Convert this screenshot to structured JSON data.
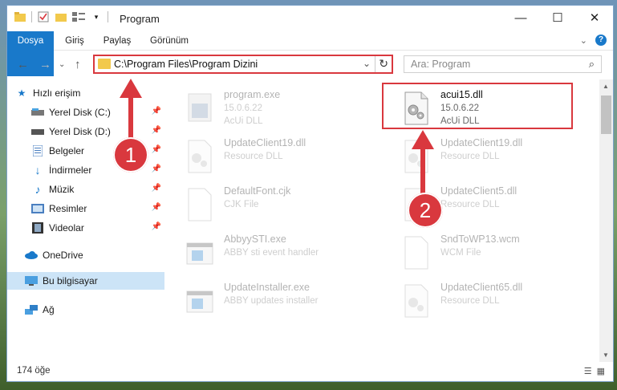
{
  "window": {
    "title": "Program",
    "controls": {
      "minimize": "—",
      "maximize": "☐",
      "close": "✕"
    }
  },
  "ribbon": {
    "tabs": [
      "Dosya",
      "Giriş",
      "Paylaş",
      "Görünüm"
    ],
    "help": "?"
  },
  "address": {
    "path": "C:\\Program Files\\Program Dizini",
    "search_placeholder": "Ara: Program"
  },
  "sidebar": {
    "items": [
      {
        "label": "Hızlı erişim",
        "icon": "star-icon"
      },
      {
        "label": "Yerel Disk (C:)",
        "icon": "drive-icon"
      },
      {
        "label": "Yerel Disk (D:)",
        "icon": "drive-icon"
      },
      {
        "label": "Belgeler",
        "icon": "documents-icon"
      },
      {
        "label": "İndirmeler",
        "icon": "download-icon"
      },
      {
        "label": "Müzik",
        "icon": "music-icon"
      },
      {
        "label": "Resimler",
        "icon": "pictures-icon"
      },
      {
        "label": "Videolar",
        "icon": "video-icon"
      },
      {
        "label": "OneDrive",
        "icon": "cloud-icon"
      },
      {
        "label": "Bu bilgisayar",
        "icon": "computer-icon"
      },
      {
        "label": "Ağ",
        "icon": "network-icon"
      }
    ]
  },
  "files": [
    {
      "name": "program.exe",
      "line2": "15.0.6.22",
      "line3": "AcUi DLL"
    },
    {
      "name": "acui15.dll",
      "line2": "15.0.6.22",
      "line3": "AcUi DLL"
    },
    {
      "name": "UpdateClient19.dll",
      "line2": "Resource DLL",
      "line3": ""
    },
    {
      "name": "UpdateClient19.dll",
      "line2": "Resource DLL",
      "line3": ""
    },
    {
      "name": "DefaultFont.cjk",
      "line2": "CJK File",
      "line3": ""
    },
    {
      "name": "UpdateClient5.dll",
      "line2": "Resource DLL",
      "line3": ""
    },
    {
      "name": "AbbyySTI.exe",
      "line2": "ABBY sti event handler",
      "line3": ""
    },
    {
      "name": "SndToWP13.wcm",
      "line2": "WCM File",
      "line3": ""
    },
    {
      "name": "UpdateInstaller.exe",
      "line2": "ABBY updates installer",
      "line3": ""
    },
    {
      "name": "UpdateClient65.dll",
      "line2": "Resource DLL",
      "line3": ""
    }
  ],
  "status": {
    "count": "174 öğe"
  },
  "callouts": {
    "one": "1",
    "two": "2"
  },
  "colors": {
    "accent": "#1979ca",
    "highlight": "#d9383e",
    "selected": "#cce4f7"
  }
}
